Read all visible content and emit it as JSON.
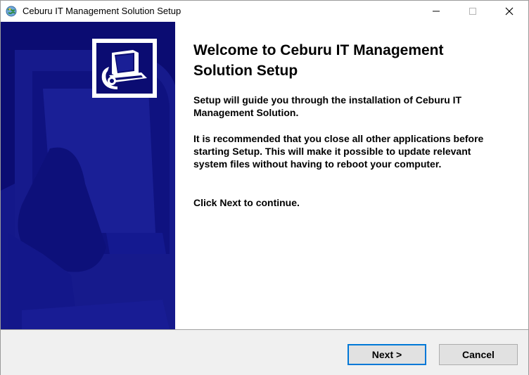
{
  "window": {
    "title": "Ceburu IT Management Solution Setup",
    "minimize_icon": "minimize-icon",
    "maximize_icon": "maximize-icon",
    "close_icon": "close-icon",
    "app_icon": "setup-globe-icon"
  },
  "banner": {
    "logo_icon": "installer-computer-icon",
    "background_color": "#0b0c72"
  },
  "content": {
    "heading": "Welcome to Ceburu IT Management Solution Setup",
    "paragraph1": "Setup will guide you through the installation of Ceburu IT Management Solution.",
    "paragraph2": "It is recommended that you close all other applications before starting Setup. This will make it possible to update relevant system files without having to reboot your computer.",
    "paragraph3": "Click Next to continue."
  },
  "buttons": {
    "next_label": "Next >",
    "cancel_label": "Cancel",
    "accent_color": "#0078d7"
  }
}
